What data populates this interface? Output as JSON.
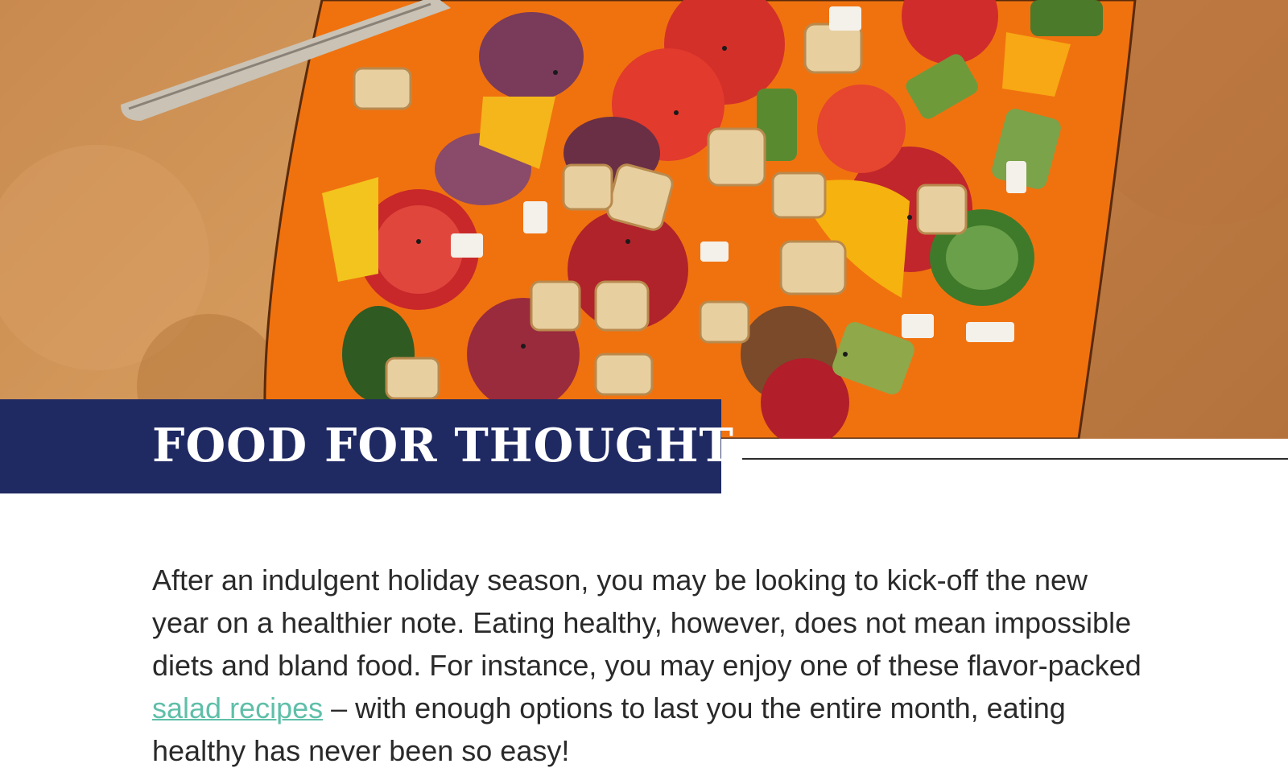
{
  "hero": {
    "image": "salad-photo",
    "colors": {
      "background": "#c98a4f",
      "plate": "#f0720f",
      "knife": "#c9c2b5"
    }
  },
  "banner": {
    "title": "FOOD FOR THOUGHT",
    "background": "#1f2a63"
  },
  "article": {
    "text_before_link": "After an indulgent holiday season, you may be looking to kick-off the new year on a healthier note. Eating healthy, however, does not mean impossible diets and bland food. For instance, you may enjoy one of these flavor-packed ",
    "link_text": "salad recipes",
    "text_after_link": " – with enough options to last you the entire month, eating healthy has never been so easy!",
    "link_color": "#5fbfa9"
  }
}
